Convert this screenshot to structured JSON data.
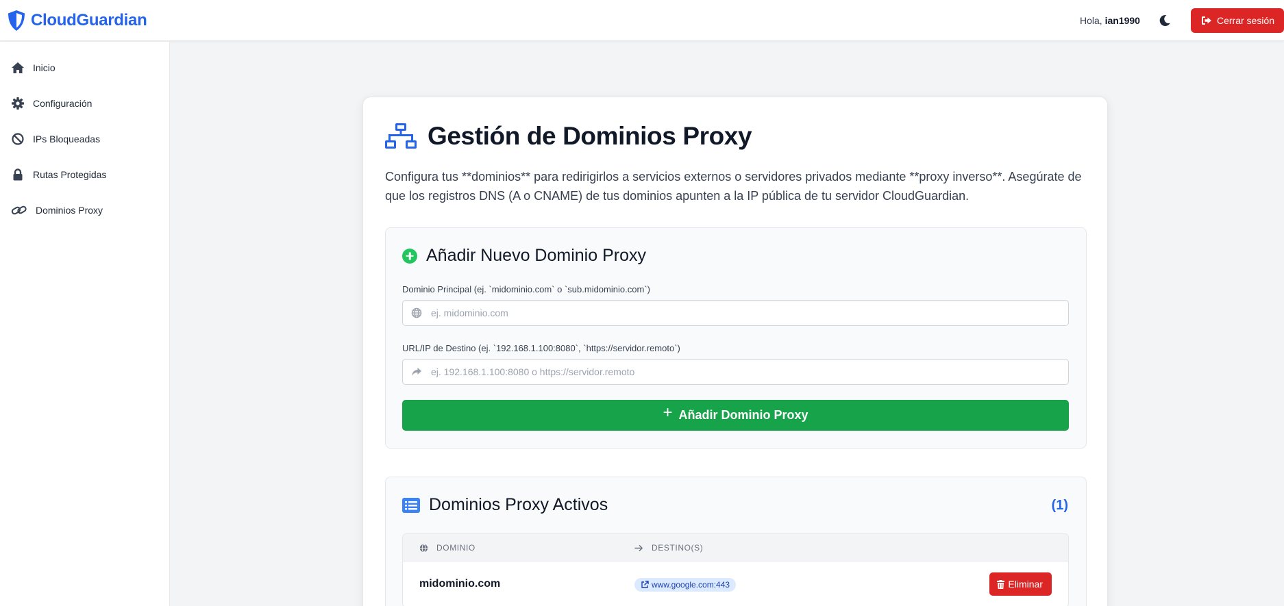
{
  "header": {
    "brand": "CloudGuardian",
    "greeting_prefix": "Hola, ",
    "username": "ian1990",
    "logout_label": "Cerrar sesión"
  },
  "sidebar": {
    "items": [
      {
        "label": "Inicio",
        "icon": "home-icon"
      },
      {
        "label": "Configuración",
        "icon": "gear-icon"
      },
      {
        "label": "IPs Bloqueadas",
        "icon": "ban-icon"
      },
      {
        "label": "Rutas Protegidas",
        "icon": "lock-icon"
      },
      {
        "label": "Dominios Proxy",
        "icon": "link-icon"
      }
    ]
  },
  "main": {
    "title": "Gestión de Dominios Proxy",
    "description": "Configura tus **dominios** para redirigirlos a servicios externos o servidores privados mediante **proxy inverso**. Asegúrate de que los registros DNS (A o CNAME) de tus dominios apunten a la IP pública de tu servidor CloudGuardian.",
    "add_section": {
      "title": "Añadir Nuevo Dominio Proxy",
      "domain_label": "Dominio Principal (ej. `midominio.com` o `sub.midominio.com`)",
      "domain_placeholder": "ej. midominio.com",
      "target_label": "URL/IP de Destino (ej. `192.168.1.100:8080`, `https://servidor.remoto`)",
      "target_placeholder": "ej. 192.168.1.100:8080 o https://servidor.remoto",
      "submit_label": "Añadir Dominio Proxy"
    },
    "active_section": {
      "title": "Dominios Proxy Activos",
      "count": "(1)",
      "columns": [
        "DOMINIO",
        "DESTINO(S)"
      ],
      "rows": [
        {
          "domain": "midominio.com",
          "destination": "www.google.com:443",
          "delete_label": "Eliminar"
        }
      ]
    }
  },
  "colors": {
    "brand": "#2563eb",
    "danger": "#dc2626",
    "success": "#16a34a",
    "badge_bg": "#dbeafe"
  }
}
